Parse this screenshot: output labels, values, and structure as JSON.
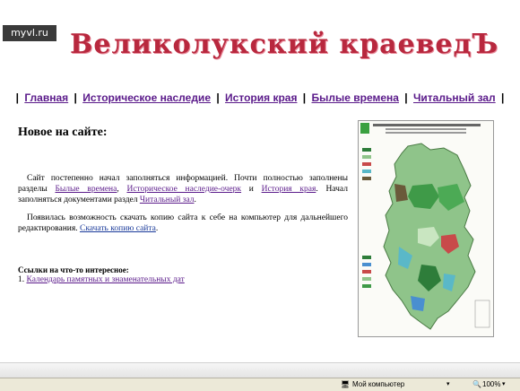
{
  "watermark": "myvl.ru",
  "logo_text": "Великолукский краеведЪ",
  "nav": [
    "Главная",
    "Историческое наследие",
    "История края",
    "Былые времена",
    "Читальный зал"
  ],
  "heading": "Новое на сайте:",
  "para1": {
    "t1": "Сайт постепенно начал заполняться информацией. Почти полностью заполнены разделы ",
    "l1": "Былые времена",
    "t2": ", ",
    "l2": "Историческое наследие-очерк",
    "t3": " и ",
    "l3": "История края",
    "t4": ". Начал заполняться документами раздел ",
    "l4": "Читальный зал",
    "t5": "."
  },
  "para2": {
    "t1": "Появилась возможность скачать копию сайта к себе на компьютер для дальнейшего редактирования. ",
    "l1": "Скачать копию сайта",
    "t2": "."
  },
  "links_title": "Ссылки на что-то интересное:",
  "links": [
    {
      "num": "1.",
      "label": "Календарь памятных и знаменательных дат"
    }
  ],
  "status": {
    "zone": "Мой компьютер",
    "zoom": "100%"
  },
  "colors": {
    "logo": "#b8283e",
    "link": "#5a1a8a",
    "link2": "#1a3a9a"
  }
}
